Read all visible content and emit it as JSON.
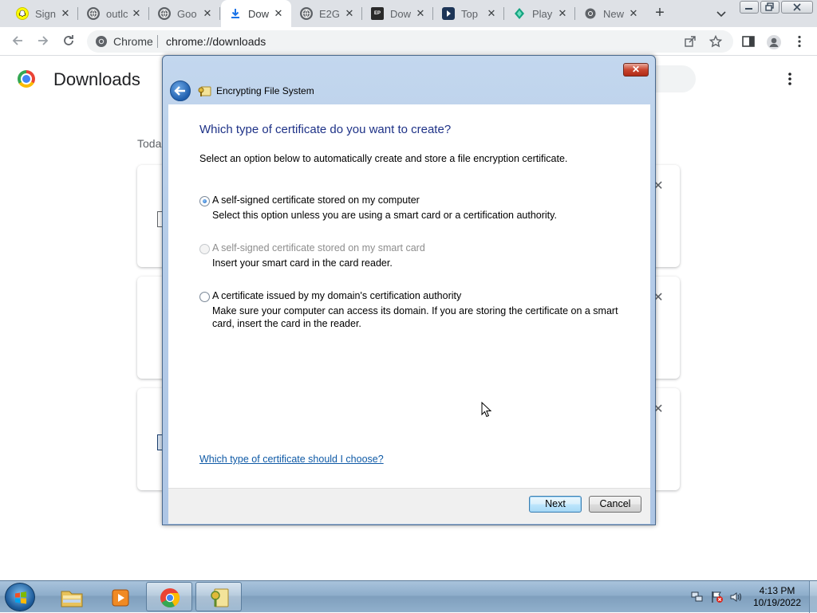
{
  "browser": {
    "tabs": [
      {
        "title": "Sign",
        "icon": "snapchat-icon",
        "color": "#fffc00"
      },
      {
        "title": "outlc",
        "icon": "globe-icon",
        "color": "#5f6368"
      },
      {
        "title": "Goo",
        "icon": "globe-icon",
        "color": "#5f6368"
      },
      {
        "title": "Dow",
        "icon": "download-icon",
        "color": "#1a73e8",
        "active": true
      },
      {
        "title": "E2G",
        "icon": "globe-icon",
        "color": "#5f6368"
      },
      {
        "title": "Dow",
        "icon": "epic-games-icon",
        "color": "#2a2a2a"
      },
      {
        "title": "Top",
        "icon": "bookmark-play-icon",
        "color": "#1d3557"
      },
      {
        "title": "Play",
        "icon": "play-store-icon",
        "color": "#14a37f"
      },
      {
        "title": "New",
        "icon": "chrome-icon",
        "color": "#5f6368"
      }
    ],
    "omnibox": {
      "site_label": "Chrome",
      "url": "chrome://downloads"
    }
  },
  "downloads_page": {
    "title": "Downloads",
    "section_label": "Toda"
  },
  "dialog": {
    "title": "Encrypting File System",
    "heading": "Which type of certificate do you want to create?",
    "intro": "Select an option below to automatically create and store a file encryption certificate.",
    "options": [
      {
        "label": "A self-signed certificate stored on my computer",
        "description": "Select this option unless you are using a smart card or a certification authority.",
        "checked": true,
        "enabled": true
      },
      {
        "label": "A self-signed certificate stored on my smart card",
        "description": "Insert your smart card in the card reader.",
        "checked": false,
        "enabled": false
      },
      {
        "label": "A certificate issued by my domain's certification authority",
        "description": "Make sure your computer can access its domain. If you are storing the certificate on a smart card, insert the card in the reader.",
        "checked": false,
        "enabled": true
      }
    ],
    "help_link": "Which type of certificate should I choose?",
    "next_label": "Next",
    "cancel_label": "Cancel"
  },
  "taskbar": {
    "time": "4:13 PM",
    "date": "10/19/2022"
  },
  "colors": {
    "dialog_heading": "#1e3287",
    "link": "#0f5aa6",
    "chrome_tabstrip": "#dee1e6"
  }
}
